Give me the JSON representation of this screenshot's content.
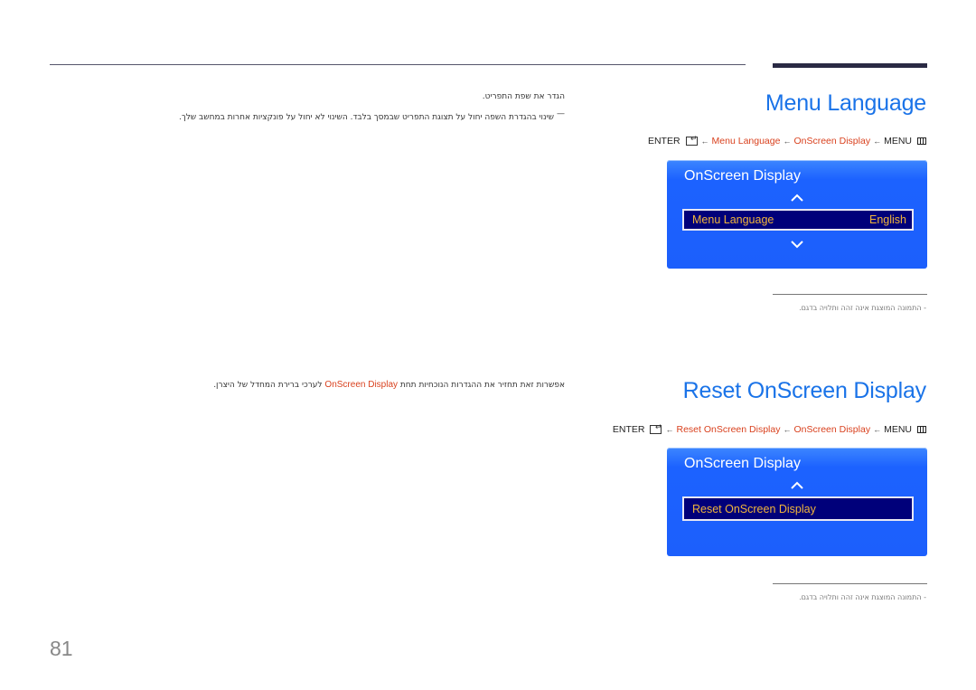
{
  "page_number": "81",
  "sections": [
    {
      "title": "Menu Language",
      "description_line1": "הגדר את שפת התפריט.",
      "note_dash": "—",
      "note_text": "שינוי בהגדרת השפה יחול על תצוגת התפריט שבמסך בלבד. השינוי לא יחול על פונקציות אחרות במחשב שלך.",
      "path": {
        "enter": "ENTER",
        "arrow": "←",
        "step1": "Menu Language",
        "step2": "OnScreen Display",
        "menu": "MENU"
      },
      "osd": {
        "title": "OnScreen Display",
        "item_label": "Menu Language",
        "item_value": "English"
      },
      "footnote": "- התמונה המוצגת אינה זהה ותלויה בדגם."
    },
    {
      "title": "Reset OnScreen Display",
      "description_before": "אפשרות זאת תחזיר את ההגדרות הנוכחיות תחת",
      "description_highlight": "OnScreen Display",
      "description_after": "לערכי ברירת המחדל של היצרן.",
      "path": {
        "enter": "ENTER",
        "arrow": "←",
        "step1": "Reset OnScreen Display",
        "step2": "OnScreen Display",
        "menu": "MENU"
      },
      "osd": {
        "title": "OnScreen Display",
        "item_label": "Reset OnScreen Display"
      },
      "footnote": "- התמונה המוצגת אינה זהה ותלויה בדגם."
    }
  ],
  "colors": {
    "title_blue": "#1a73e8",
    "path_red": "#d9411e",
    "osd_blue": "#1c5ffc",
    "osd_item_bg": "#00007a",
    "osd_item_text": "#f0b43c"
  }
}
